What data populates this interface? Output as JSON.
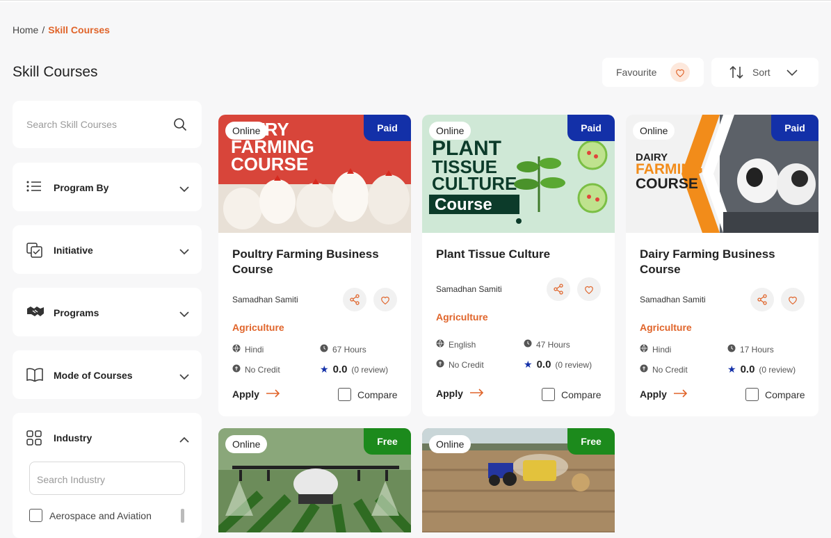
{
  "breadcrumb": {
    "home": "Home",
    "separator": "/",
    "current": "Skill Courses"
  },
  "page_title": "Skill Courses",
  "favourite_label": "Favourite",
  "sort_label": "Sort",
  "sidebar": {
    "search_placeholder": "Search Skill Courses",
    "filters": [
      {
        "label": "Program By",
        "icon": "list-icon"
      },
      {
        "label": "Initiative",
        "icon": "checklist-icon"
      },
      {
        "label": "Programs",
        "icon": "handshake-icon"
      },
      {
        "label": "Mode of Courses",
        "icon": "book-icon"
      },
      {
        "label": "Industry",
        "icon": "grid-icon"
      }
    ],
    "industry_search_placeholder": "Search Industry",
    "industry_options": [
      "Aerospace and Aviation"
    ]
  },
  "courses": [
    {
      "mode": "Online",
      "price": "Paid",
      "title": "Poultry Farming Business Course",
      "provider": "Samadhan Samiti",
      "category": "Agriculture",
      "language": "Hindi",
      "duration": "67 Hours",
      "credit": "No Credit",
      "rating": "0.0",
      "reviews": "(0 review)",
      "apply": "Apply",
      "compare": "Compare",
      "banner": [
        "ULTRY",
        "FARMING",
        "COURSE"
      ]
    },
    {
      "mode": "Online",
      "price": "Paid",
      "title": "Plant Tissue Culture",
      "provider": "Samadhan Samiti",
      "category": "Agriculture",
      "language": "English",
      "duration": "47 Hours",
      "credit": "No Credit",
      "rating": "0.0",
      "reviews": "(0 review)",
      "apply": "Apply",
      "compare": "Compare",
      "banner": [
        "PLANT",
        "TISSUE",
        "CULTURE",
        "Course"
      ]
    },
    {
      "mode": "Online",
      "price": "Paid",
      "title": "Dairy Farming Business Course",
      "provider": "Samadhan Samiti",
      "category": "Agriculture",
      "language": "Hindi",
      "duration": "17 Hours",
      "credit": "No Credit",
      "rating": "0.0",
      "reviews": "(0 review)",
      "apply": "Apply",
      "compare": "Compare",
      "banner": [
        "DAIRY",
        "FARMING",
        "COURSE"
      ]
    },
    {
      "mode": "Online",
      "price": "Free"
    },
    {
      "mode": "Online",
      "price": "Free"
    }
  ],
  "colors": {
    "accent": "#e0642a",
    "paid": "#1330a8",
    "free": "#1c8a1c"
  }
}
